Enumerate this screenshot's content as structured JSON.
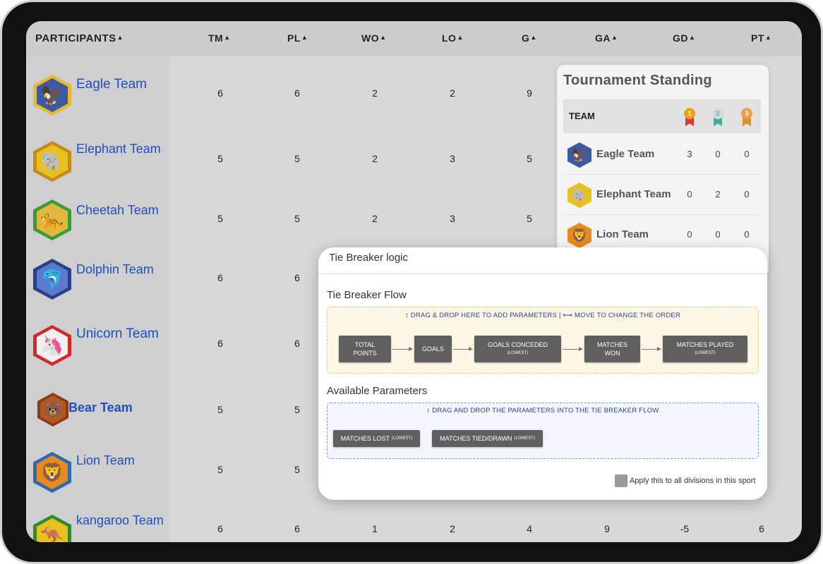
{
  "table": {
    "headers": {
      "participants": "PARTICIPANTS",
      "tm": "TM",
      "pl": "PL",
      "wo": "WO",
      "lo": "LO",
      "g": "G",
      "ga": "GA",
      "gd": "GD",
      "pt": "PT",
      "sort_glyph": "▲"
    },
    "rows": [
      {
        "name": "Eagle Team",
        "tm": "6",
        "pl": "6",
        "wo": "2",
        "lo": "2",
        "g": "9",
        "ga": "",
        "gd": "",
        "pt": ""
      },
      {
        "name": "Elephant Team",
        "tm": "5",
        "pl": "5",
        "wo": "2",
        "lo": "3",
        "g": "5",
        "ga": "",
        "gd": "",
        "pt": ""
      },
      {
        "name": "Cheetah Team",
        "tm": "5",
        "pl": "5",
        "wo": "2",
        "lo": "3",
        "g": "5",
        "ga": "",
        "gd": "",
        "pt": ""
      },
      {
        "name": "Dolphin Team",
        "tm": "6",
        "pl": "6",
        "wo": "",
        "lo": "",
        "g": "",
        "ga": "",
        "gd": "",
        "pt": ""
      },
      {
        "name": "Unicorn Team",
        "tm": "6",
        "pl": "6",
        "wo": "",
        "lo": "",
        "g": "",
        "ga": "",
        "gd": "",
        "pt": ""
      },
      {
        "name": "Bear Team",
        "tm": "5",
        "pl": "5",
        "wo": "",
        "lo": "",
        "g": "",
        "ga": "",
        "gd": "",
        "pt": ""
      },
      {
        "name": "Lion Team",
        "tm": "5",
        "pl": "5",
        "wo": "",
        "lo": "",
        "g": "",
        "ga": "",
        "gd": "",
        "pt": ""
      },
      {
        "name": "kangaroo Team",
        "tm": "6",
        "pl": "6",
        "wo": "1",
        "lo": "2",
        "g": "4",
        "ga": "9",
        "gd": "-5",
        "pt": "6"
      }
    ]
  },
  "standing": {
    "title": "Tournament Standing",
    "team_header": "TEAM",
    "medals": [
      "1",
      "2",
      "3"
    ],
    "rows": [
      {
        "name": "Eagle Team",
        "gold": "3",
        "silver": "0",
        "bronze": "0"
      },
      {
        "name": "Elephant Team",
        "gold": "0",
        "silver": "2",
        "bronze": "0"
      },
      {
        "name": "Lion Team",
        "gold": "0",
        "silver": "0",
        "bronze": "0"
      }
    ]
  },
  "tiebreaker": {
    "title": "Tie Breaker logic",
    "flow_title": "Tie Breaker Flow",
    "flow_hint_drag": "DRAG & DROP HERE TO ADD PARAMETERS",
    "flow_hint_sep": "|",
    "flow_hint_move": "MOVE TO CHANGE THE ORDER",
    "flow_items": [
      {
        "label": "TOTAL",
        "label2": "POINTS",
        "sub": ""
      },
      {
        "label": "GOALS",
        "label2": "",
        "sub": ""
      },
      {
        "label": "GOALS CONCEDED",
        "label2": "",
        "sub": "(LOWEST)"
      },
      {
        "label": "MATCHES",
        "label2": "WON",
        "sub": ""
      },
      {
        "label": "MATCHES PLAYED",
        "label2": "",
        "sub": "(LOWEST)"
      }
    ],
    "available_title": "Available Parameters",
    "available_hint": "DRAG AND DROP THE PARAMETERS INTO THE TIE BREAKER FLOW",
    "available_items": [
      {
        "label": "MATCHES LOST",
        "sub": "(LOWEST)"
      },
      {
        "label": "MATCHES TIED/DRAWN",
        "sub": "(LOWEST)"
      }
    ],
    "apply_label": "Apply this to all divisions in this sport"
  },
  "colors": {
    "team_name": "#1f4fbf",
    "gold": "#e8a317",
    "silver": "#9fd8c8",
    "bronze": "#e0902a",
    "param_button": "#5f5f5f"
  }
}
